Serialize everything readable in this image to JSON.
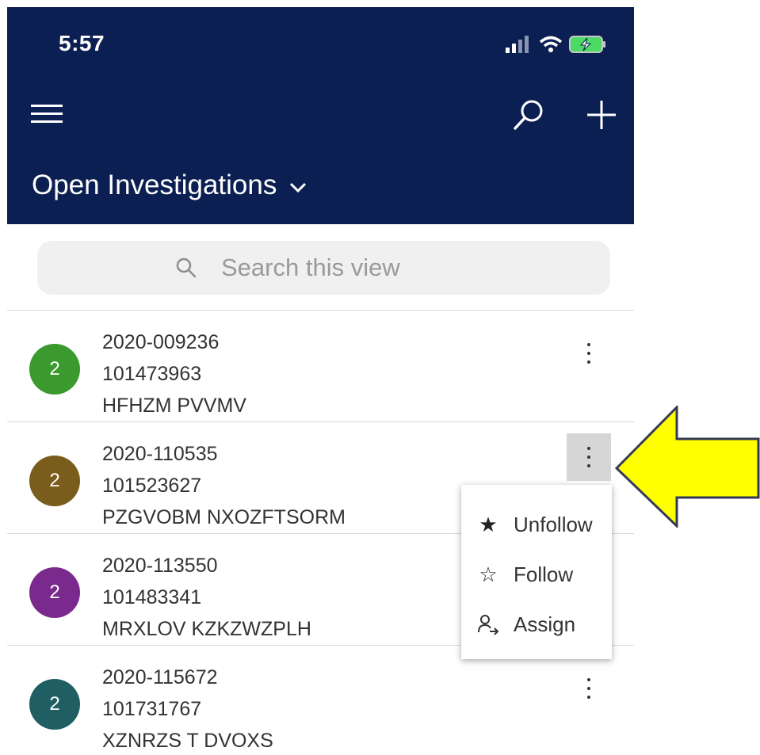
{
  "status_bar": {
    "time": "5:57"
  },
  "header": {
    "view_title": "Open Investigations",
    "color": "#0c1f52"
  },
  "search": {
    "placeholder": "Search this view"
  },
  "records": [
    {
      "avatar": "2",
      "avatar_color": "#3a9a2e",
      "id": "2020-009236",
      "number": "101473963",
      "name": "HFHZM PVVMV"
    },
    {
      "avatar": "2",
      "avatar_color": "#7a5c1c",
      "id": "2020-110535",
      "number": "101523627",
      "name": "PZGVOBM NXOZFTSORM"
    },
    {
      "avatar": "2",
      "avatar_color": "#7a2a8c",
      "id": "2020-113550",
      "number": "101483341",
      "name": "MRXLOV KZKZWZPLH"
    },
    {
      "avatar": "2",
      "avatar_color": "#1f5f64",
      "id": "2020-115672",
      "number": "101731767",
      "name": "XZNRZS T DVOXS"
    }
  ],
  "context_menu": {
    "items": [
      {
        "label": "Unfollow",
        "icon": "star-filled-icon"
      },
      {
        "label": "Follow",
        "icon": "star-outline-icon"
      },
      {
        "label": "Assign",
        "icon": "assign-person-icon"
      }
    ]
  },
  "annotation": {
    "color": "#ffff00"
  }
}
